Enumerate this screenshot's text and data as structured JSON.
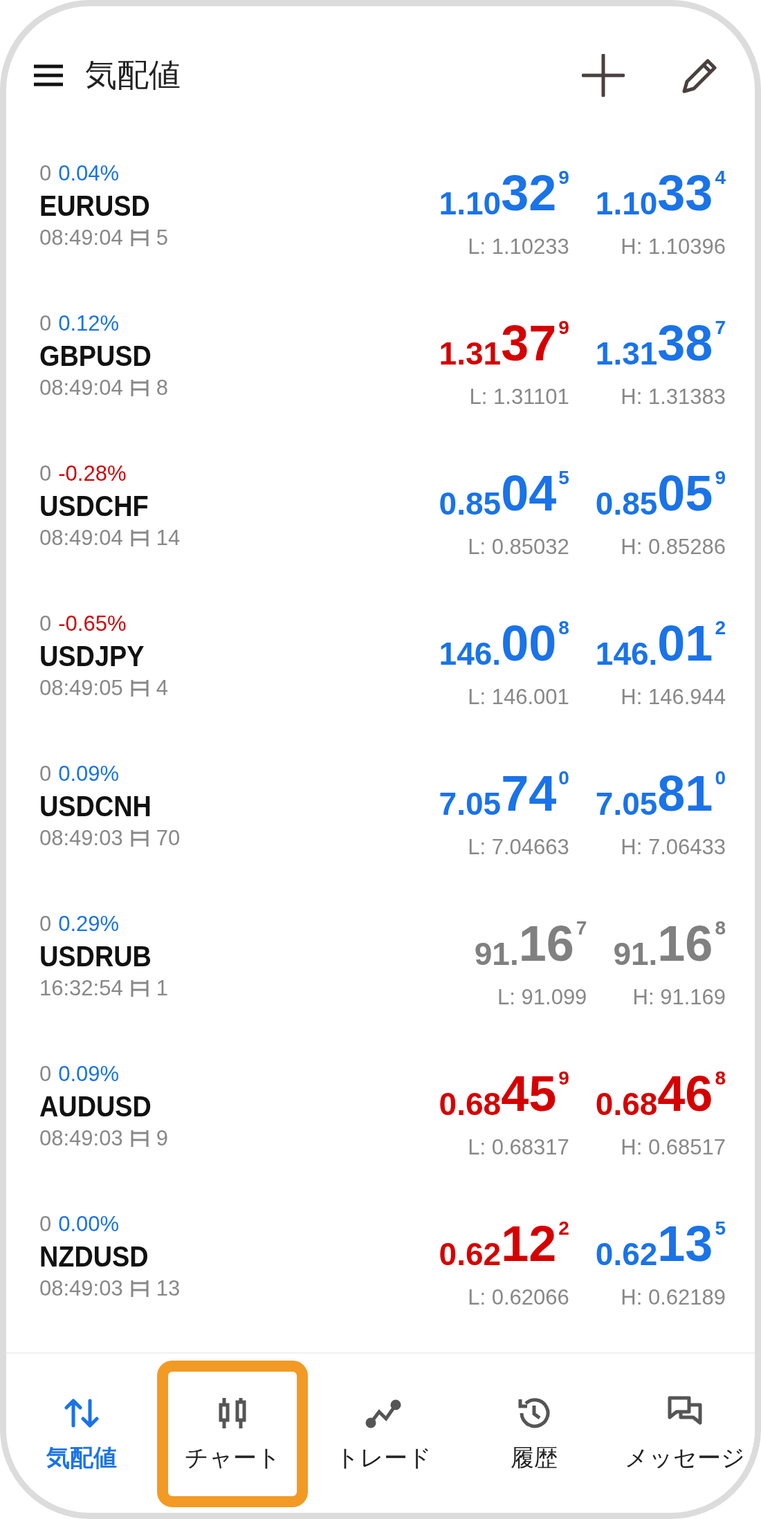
{
  "header": {
    "title": "気配値"
  },
  "quotes": [
    {
      "change": "0",
      "percent": "0.04%",
      "negative": false,
      "symbol": "EURUSD",
      "time": "08:49:04",
      "spread": "5",
      "bid": {
        "prefix": "1.10",
        "main": "32",
        "sup": "9",
        "color": "#1a73e8"
      },
      "ask": {
        "prefix": "1.10",
        "main": "33",
        "sup": "4",
        "color": "#1a73e8"
      },
      "low": "L: 1.10233",
      "high": "H: 1.10396"
    },
    {
      "change": "0",
      "percent": "0.12%",
      "negative": false,
      "symbol": "GBPUSD",
      "time": "08:49:04",
      "spread": "8",
      "bid": {
        "prefix": "1.31",
        "main": "37",
        "sup": "9",
        "color": "#d50000"
      },
      "ask": {
        "prefix": "1.31",
        "main": "38",
        "sup": "7",
        "color": "#1a73e8"
      },
      "low": "L: 1.31101",
      "high": "H: 1.31383"
    },
    {
      "change": "0",
      "percent": "-0.28%",
      "negative": true,
      "symbol": "USDCHF",
      "time": "08:49:04",
      "spread": "14",
      "bid": {
        "prefix": "0.85",
        "main": "04",
        "sup": "5",
        "color": "#1a73e8"
      },
      "ask": {
        "prefix": "0.85",
        "main": "05",
        "sup": "9",
        "color": "#1a73e8"
      },
      "low": "L: 0.85032",
      "high": "H: 0.85286"
    },
    {
      "change": "0",
      "percent": "-0.65%",
      "negative": true,
      "symbol": "USDJPY",
      "time": "08:49:05",
      "spread": "4",
      "bid": {
        "prefix": "146.",
        "main": "00",
        "sup": "8",
        "color": "#1a73e8"
      },
      "ask": {
        "prefix": "146.",
        "main": "01",
        "sup": "2",
        "color": "#1a73e8"
      },
      "low": "L: 146.001",
      "high": "H: 146.944"
    },
    {
      "change": "0",
      "percent": "0.09%",
      "negative": false,
      "symbol": "USDCNH",
      "time": "08:49:03",
      "spread": "70",
      "bid": {
        "prefix": "7.05",
        "main": "74",
        "sup": "0",
        "color": "#1a73e8"
      },
      "ask": {
        "prefix": "7.05",
        "main": "81",
        "sup": "0",
        "color": "#1a73e8"
      },
      "low": "L: 7.04663",
      "high": "H: 7.06433"
    },
    {
      "change": "0",
      "percent": "0.29%",
      "negative": false,
      "symbol": "USDRUB",
      "time": "16:32:54",
      "spread": "1",
      "bid": {
        "prefix": "91.",
        "main": "16",
        "sup": "7",
        "color": "#808080"
      },
      "ask": {
        "prefix": "91.",
        "main": "16",
        "sup": "8",
        "color": "#808080"
      },
      "low": "L: 91.099",
      "high": "H: 91.169"
    },
    {
      "change": "0",
      "percent": "0.09%",
      "negative": false,
      "symbol": "AUDUSD",
      "time": "08:49:03",
      "spread": "9",
      "bid": {
        "prefix": "0.68",
        "main": "45",
        "sup": "9",
        "color": "#d50000"
      },
      "ask": {
        "prefix": "0.68",
        "main": "46",
        "sup": "8",
        "color": "#d50000"
      },
      "low": "L: 0.68317",
      "high": "H: 0.68517"
    },
    {
      "change": "0",
      "percent": "0.00%",
      "negative": false,
      "symbol": "NZDUSD",
      "time": "08:49:03",
      "spread": "13",
      "bid": {
        "prefix": "0.62",
        "main": "12",
        "sup": "2",
        "color": "#d50000"
      },
      "ask": {
        "prefix": "0.62",
        "main": "13",
        "sup": "5",
        "color": "#1a73e8"
      },
      "low": "L: 0.62066",
      "high": "H: 0.62189"
    }
  ],
  "nav": [
    {
      "kind": "quotes",
      "label": "気配値",
      "selected": true,
      "highlighted": false
    },
    {
      "kind": "chart",
      "label": "チャート",
      "selected": false,
      "highlighted": true
    },
    {
      "kind": "trade",
      "label": "トレード",
      "selected": false,
      "highlighted": false
    },
    {
      "kind": "history",
      "label": "履歴",
      "selected": false,
      "highlighted": false
    },
    {
      "kind": "messages",
      "label": "メッセージ",
      "selected": false,
      "highlighted": false
    }
  ]
}
